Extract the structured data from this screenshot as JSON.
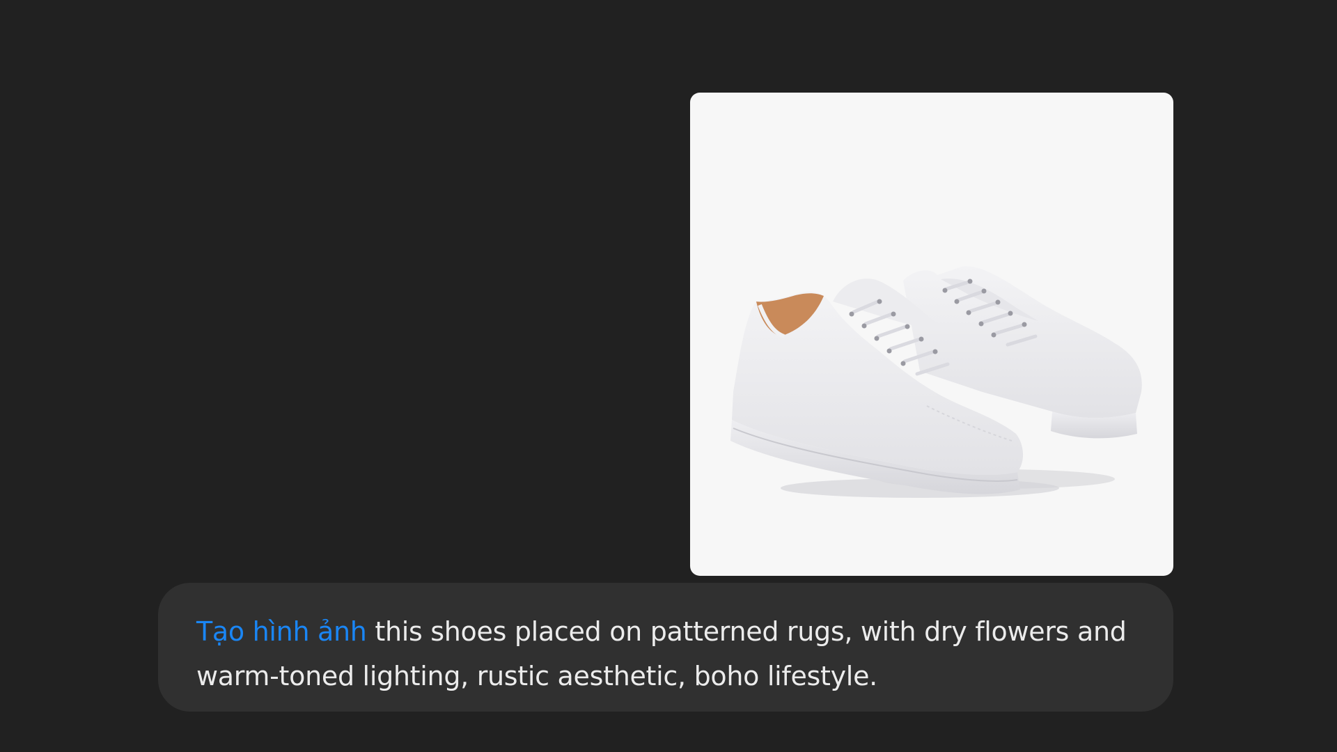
{
  "message": {
    "tag_text": "Tạo hình ảnh",
    "prompt_text": " this shoes placed on patterned rugs, with dry flowers and warm-toned lighting, rustic aesthetic, boho lifestyle.",
    "tag_color": "#1a86f5"
  },
  "attachment": {
    "icon": "white-sneakers-image",
    "background": "#f7f7f7"
  },
  "colors": {
    "page_background": "#212121",
    "bubble_background": "#303030",
    "text": "#ececec"
  }
}
